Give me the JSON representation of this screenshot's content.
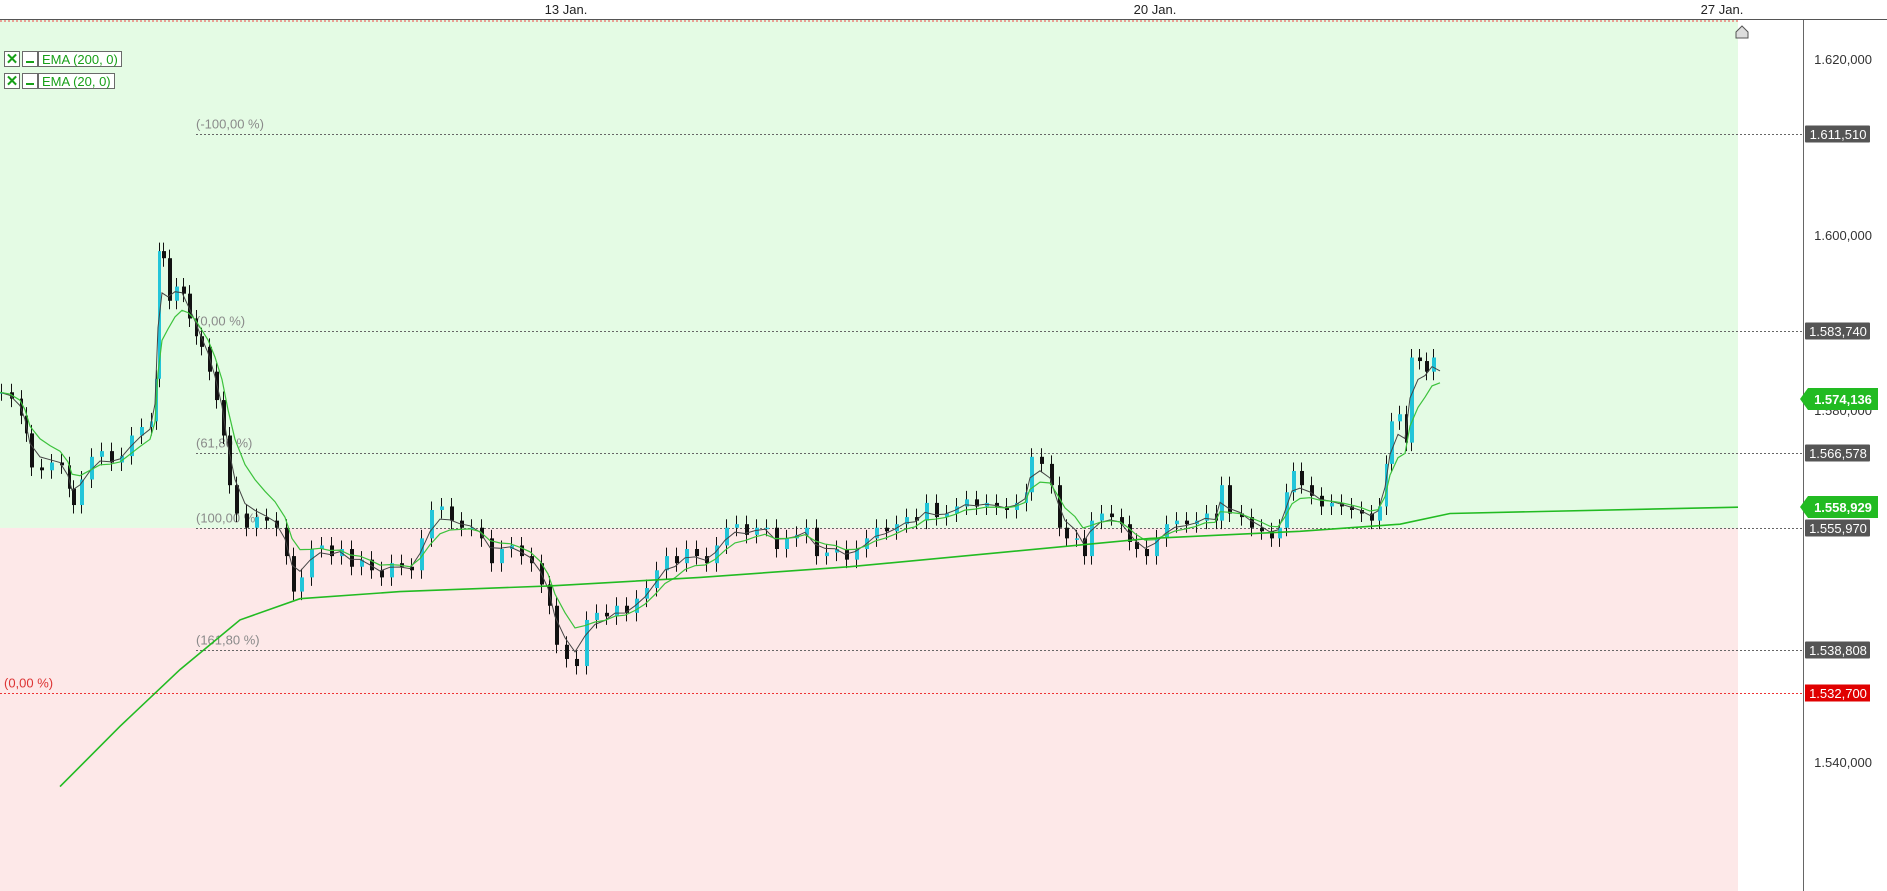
{
  "chart_data": {
    "type": "candlestick",
    "x_ticks": [
      "13 Jan.",
      "20 Jan.",
      "27 Jan."
    ],
    "y_ticks": [
      "1.620,000",
      "1.600,000",
      "1.580,000",
      "1.540,000"
    ],
    "ylim": [
      1.521,
      1.623
    ],
    "grid": false,
    "legend": [
      {
        "name": "EMA (200, 0)",
        "color": "#22bb22"
      },
      {
        "name": "EMA (20, 0)",
        "color": "#22bb22"
      }
    ],
    "fib_levels": [
      {
        "label": "(-100,00 %)",
        "price": 1.61151,
        "price_label": "1.611,510"
      },
      {
        "label": "(0,00 %)",
        "price": 1.58374,
        "price_label": "1.583,740"
      },
      {
        "label": "(61,80 %)",
        "price": 1.566578,
        "price_label": "1.566,578"
      },
      {
        "label": "(100,00 %)",
        "price": 1.55597,
        "price_label": "1.555,970"
      },
      {
        "label": "(161,80 %)",
        "price": 1.538808,
        "price_label": "1.538,808"
      }
    ],
    "stop_level": {
      "label": "(0,00 %)",
      "price": 1.5327,
      "price_label": "1.532,700"
    },
    "ema_labels": [
      {
        "price": 1.574136,
        "label": "1.574,136"
      },
      {
        "price": 1.558929,
        "label": "1.558,929"
      }
    ],
    "price_series": [
      [
        0,
        1.5751
      ],
      [
        10,
        1.5742
      ],
      [
        20,
        1.5718
      ],
      [
        25,
        1.5693
      ],
      [
        30,
        1.5645
      ],
      [
        40,
        1.5641
      ],
      [
        50,
        1.5652
      ],
      [
        60,
        1.5648
      ],
      [
        68,
        1.5615
      ],
      [
        72,
        1.5592
      ],
      [
        80,
        1.5628
      ],
      [
        90,
        1.566
      ],
      [
        100,
        1.5668
      ],
      [
        110,
        1.5652
      ],
      [
        120,
        1.5661
      ],
      [
        130,
        1.569
      ],
      [
        140,
        1.5702
      ],
      [
        150,
        1.571
      ],
      [
        155,
        1.577
      ],
      [
        158,
        1.595
      ],
      [
        162,
        1.594
      ],
      [
        168,
        1.588
      ],
      [
        175,
        1.59
      ],
      [
        182,
        1.589
      ],
      [
        188,
        1.5855
      ],
      [
        195,
        1.583
      ],
      [
        200,
        1.5815
      ],
      [
        208,
        1.578
      ],
      [
        215,
        1.574
      ],
      [
        222,
        1.569
      ],
      [
        228,
        1.562
      ],
      [
        235,
        1.558
      ],
      [
        245,
        1.556
      ],
      [
        255,
        1.5575
      ],
      [
        265,
        1.557
      ],
      [
        275,
        1.556
      ],
      [
        285,
        1.552
      ],
      [
        292,
        1.547
      ],
      [
        300,
        1.549
      ],
      [
        310,
        1.553
      ],
      [
        320,
        1.5535
      ],
      [
        330,
        1.552
      ],
      [
        340,
        1.553
      ],
      [
        350,
        1.5505
      ],
      [
        360,
        1.5515
      ],
      [
        370,
        1.55
      ],
      [
        380,
        1.549
      ],
      [
        390,
        1.551
      ],
      [
        400,
        1.5505
      ],
      [
        410,
        1.55
      ],
      [
        420,
        1.5545
      ],
      [
        430,
        1.5585
      ],
      [
        440,
        1.559
      ],
      [
        450,
        1.557
      ],
      [
        460,
        1.556
      ],
      [
        470,
        1.556
      ],
      [
        480,
        1.5545
      ],
      [
        490,
        1.551
      ],
      [
        500,
        1.553
      ],
      [
        510,
        1.5535
      ],
      [
        520,
        1.552
      ],
      [
        530,
        1.551
      ],
      [
        540,
        1.548
      ],
      [
        548,
        1.545
      ],
      [
        555,
        1.5395
      ],
      [
        565,
        1.5375
      ],
      [
        575,
        1.5365
      ],
      [
        585,
        1.543
      ],
      [
        595,
        1.544
      ],
      [
        605,
        1.5435
      ],
      [
        615,
        1.545
      ],
      [
        625,
        1.544
      ],
      [
        635,
        1.546
      ],
      [
        645,
        1.5475
      ],
      [
        655,
        1.55
      ],
      [
        665,
        1.552
      ],
      [
        675,
        1.551
      ],
      [
        685,
        1.553
      ],
      [
        695,
        1.552
      ],
      [
        705,
        1.551
      ],
      [
        715,
        1.5535
      ],
      [
        725,
        1.556
      ],
      [
        735,
        1.5565
      ],
      [
        745,
        1.555
      ],
      [
        755,
        1.556
      ],
      [
        765,
        1.556
      ],
      [
        775,
        1.553
      ],
      [
        785,
        1.5545
      ],
      [
        795,
        1.555
      ],
      [
        805,
        1.556
      ],
      [
        815,
        1.552
      ],
      [
        825,
        1.5525
      ],
      [
        835,
        1.553
      ],
      [
        845,
        1.5515
      ],
      [
        855,
        1.553
      ],
      [
        865,
        1.5545
      ],
      [
        875,
        1.556
      ],
      [
        885,
        1.5555
      ],
      [
        895,
        1.5565
      ],
      [
        905,
        1.5575
      ],
      [
        915,
        1.557
      ],
      [
        925,
        1.5595
      ],
      [
        935,
        1.5575
      ],
      [
        945,
        1.558
      ],
      [
        955,
        1.559
      ],
      [
        965,
        1.56
      ],
      [
        975,
        1.559
      ],
      [
        985,
        1.5595
      ],
      [
        995,
        1.559
      ],
      [
        1005,
        1.5585
      ],
      [
        1015,
        1.5595
      ],
      [
        1025,
        1.561
      ],
      [
        1030,
        1.566
      ],
      [
        1040,
        1.565
      ],
      [
        1050,
        1.562
      ],
      [
        1058,
        1.556
      ],
      [
        1065,
        1.5545
      ],
      [
        1075,
        1.5545
      ],
      [
        1083,
        1.552
      ],
      [
        1090,
        1.557
      ],
      [
        1100,
        1.558
      ],
      [
        1110,
        1.5575
      ],
      [
        1120,
        1.5565
      ],
      [
        1128,
        1.554
      ],
      [
        1135,
        1.553
      ],
      [
        1145,
        1.552
      ],
      [
        1155,
        1.5545
      ],
      [
        1165,
        1.5565
      ],
      [
        1175,
        1.557
      ],
      [
        1185,
        1.5565
      ],
      [
        1195,
        1.557
      ],
      [
        1205,
        1.558
      ],
      [
        1215,
        1.557
      ],
      [
        1220,
        1.562
      ],
      [
        1228,
        1.558
      ],
      [
        1240,
        1.5575
      ],
      [
        1250,
        1.556
      ],
      [
        1260,
        1.5555
      ],
      [
        1270,
        1.5545
      ],
      [
        1278,
        1.556
      ],
      [
        1285,
        1.561
      ],
      [
        1292,
        1.564
      ],
      [
        1300,
        1.562
      ],
      [
        1310,
        1.5605
      ],
      [
        1320,
        1.559
      ],
      [
        1330,
        1.5595
      ],
      [
        1340,
        1.559
      ],
      [
        1350,
        1.5585
      ],
      [
        1360,
        1.558
      ],
      [
        1370,
        1.557
      ],
      [
        1378,
        1.559
      ],
      [
        1385,
        1.565
      ],
      [
        1390,
        1.571
      ],
      [
        1398,
        1.572
      ],
      [
        1405,
        1.568
      ],
      [
        1410,
        1.58
      ],
      [
        1418,
        1.5795
      ],
      [
        1425,
        1.578
      ],
      [
        1432,
        1.58
      ],
      [
        1440,
        1.5775
      ]
    ]
  },
  "legend_ui": {
    "checkbox_glyph": "✕"
  }
}
